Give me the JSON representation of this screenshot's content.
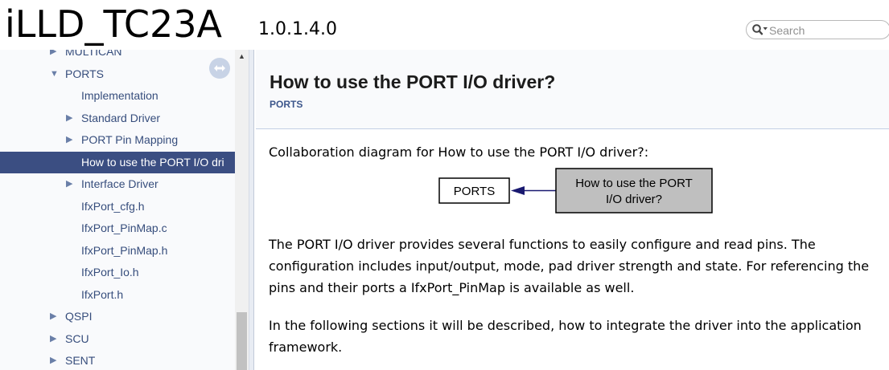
{
  "header": {
    "project_name": "iLLD_TC23A",
    "project_number": "1.0.1.4.0",
    "search": {
      "placeholder": "Search"
    }
  },
  "sidebar": {
    "items": [
      {
        "label": "MULTICAN",
        "expander": "collapsed"
      },
      {
        "label": "PORTS",
        "expander": "expanded"
      },
      {
        "label": "Implementation",
        "expander": "none"
      },
      {
        "label": "Standard Driver",
        "expander": "collapsed"
      },
      {
        "label": "PORT Pin Mapping",
        "expander": "collapsed"
      },
      {
        "label": "How to use the PORT I/O dri",
        "expander": "none",
        "selected": true
      },
      {
        "label": "Interface Driver",
        "expander": "collapsed"
      },
      {
        "label": "IfxPort_cfg.h",
        "expander": "none"
      },
      {
        "label": "IfxPort_PinMap.c",
        "expander": "none"
      },
      {
        "label": "IfxPort_PinMap.h",
        "expander": "none"
      },
      {
        "label": "IfxPort_Io.h",
        "expander": "none"
      },
      {
        "label": "IfxPort.h",
        "expander": "none"
      },
      {
        "label": "QSPI",
        "expander": "collapsed"
      },
      {
        "label": "SCU",
        "expander": "collapsed"
      },
      {
        "label": "SENT",
        "expander": "collapsed"
      }
    ],
    "selected_color": "#3b4e82",
    "link_color": "#364d7c"
  },
  "main": {
    "title": "How to use the PORT I/O driver?",
    "ingroup": "PORTS",
    "collab_caption": "Collaboration diagram for How to use the PORT I/O driver?:",
    "diagram": {
      "left_node": "PORTS",
      "right_node_line1": "How to use the PORT",
      "right_node_line2": "I/O driver?",
      "right_node_fill": "#bfbfbf",
      "edge_color": "#191970"
    },
    "paragraphs": [
      "The PORT I/O driver provides several functions to easily configure and read pins. The configuration includes input/output, mode, pad driver strength and state. For referencing the pins and their ports a IfxPort_PinMap is available as well.",
      "In the following sections it will be described, how to integrate the driver into the application framework."
    ]
  }
}
